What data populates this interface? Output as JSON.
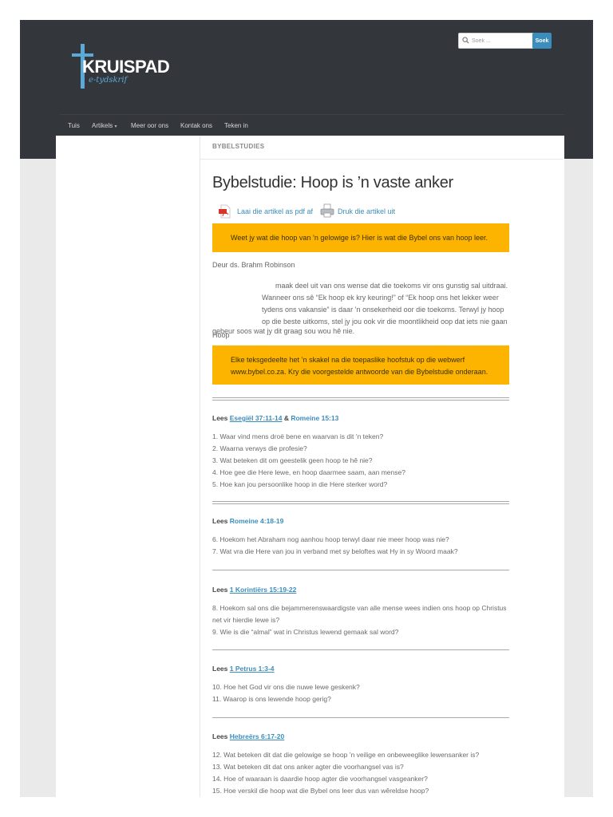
{
  "header": {
    "logo": {
      "name": "KRUISPAD",
      "tagline": "e-tydskrif"
    },
    "search": {
      "placeholder": "Soek ...",
      "button": "Soek"
    },
    "nav": [
      {
        "label": "Tuis"
      },
      {
        "label": "Artikels",
        "caret": "▾"
      },
      {
        "label": "Meer oor ons"
      },
      {
        "label": "Kontak ons"
      },
      {
        "label": "Teken in"
      }
    ]
  },
  "article": {
    "category": "BYBELSTUDIES",
    "title": "Bybelstudie: Hoop is ’n vaste anker",
    "actions": {
      "pdf": "Laai die artikel as pdf af",
      "print": "Druk die artikel uit"
    },
    "callout1": "Weet jy wat die hoop van ’n gelowige is? Hier is wat die Bybel ons van hoop leer.",
    "author": "Deur ds. Brahm Robinson",
    "intro_dropword": "Hoop",
    "intro_line1": "maak deel uit van ons wense dat die toekoms vir ons gunstig sal uitdraai.",
    "intro_rest": "Wanneer ons sê “Ek hoop ek kry keuring!” of “Ek hoop ons het lekker weer tydens ons vakansie” is daar ’n onsekerheid oor die toekoms. Terwyl jy hoop op die beste uitkoms, stel jy jou ook vir die moontlikheid oop dat iets nie gaan",
    "intro_end": "gebeur soos wat jy dit graag sou wou hê nie.",
    "callout2": "Elke teksgedeelte het ’n skakel na die toepaslike hoofstuk op die webwerf www.bybel.co.za. Kry die voorgestelde antwoorde van die Bybelstudie onderaan.",
    "lees_label": "Lees",
    "sections": [
      {
        "ref": "Esegiël 37:11-14",
        "amp": "&",
        "ref2": "Romeine 15:13",
        "questions": [
          "1. Waar vind mens droë bene en waarvan is dit ’n teken?",
          "2. Waarna verwys die profesie?",
          "3. Wat beteken dit om geestelik geen hoop te hê nie?",
          "4. Hoe gee die Here lewe, en hoop daarmee saam, aan mense?",
          "5. Hoe kan jou persoonlike hoop in die Here sterker word?"
        ]
      },
      {
        "ref": "Romeine 4:18-19",
        "questions": [
          "6. Hoekom het Abraham nog aanhou hoop terwyl daar nie meer hoop was nie?",
          "7.  Wat vra die Here van jou in verband met sy beloftes wat Hy in sy Woord maak?"
        ]
      },
      {
        "ref": "1 Korintiërs 15:19-22",
        "questions": [
          "8. Hoekom sal ons die bejammerenswaardigste van alle mense wees indien ons hoop op Christus net vir hierdie lewe is?",
          "9. Wie is die “almal” wat in Christus lewend gemaak sal word?"
        ]
      },
      {
        "ref": "1 Petrus 1:3-4",
        "questions": [
          "10. Hoe het God vir ons die nuwe lewe geskenk?",
          "11. Waarop is ons lewende hoop gerig?"
        ]
      },
      {
        "ref": "Hebreërs 6:17-20",
        "questions": [
          "12. Wat beteken dit dat die gelowige se hoop ’n veilige en onbeweeglike lewensanker is?",
          "13. Wat beteken dit dat ons anker agter die voorhangsel vas is?",
          "14. Hoe of waaraan is daardie hoop agter die voorhangsel vasgeanker?",
          "15. Hoe verskil die hoop wat die Bybel ons leer dus van wêreldse hoop?"
        ]
      }
    ]
  },
  "colors": {
    "header_bg": "#33363b",
    "accent_blue": "#3b8dbd",
    "callout_yellow": "#fcb400",
    "page_bg": "#eaeaea"
  },
  "icons": {
    "pdf": "pdf-file-icon",
    "print": "printer-icon",
    "search": "search-icon",
    "logo": "cross-logo-icon"
  }
}
